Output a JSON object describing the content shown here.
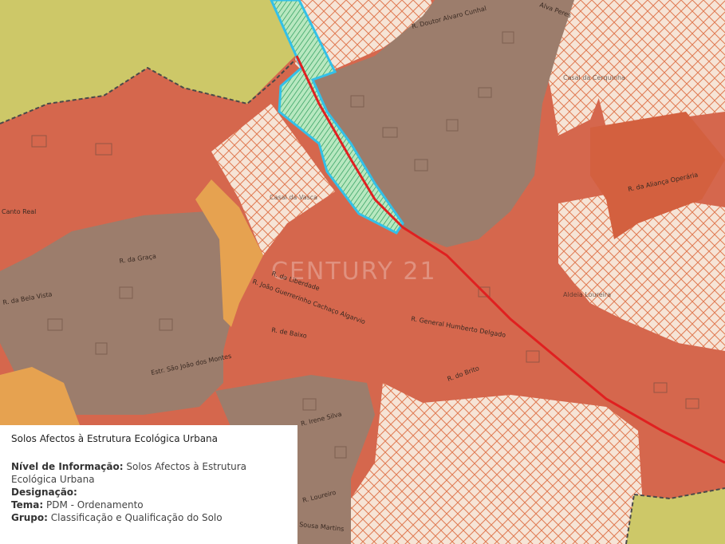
{
  "map": {
    "streets": [
      "R. Doutor Alvaro Cunhal",
      "R. da Graça",
      "R. da Bela Vista",
      "Estr. São João dos Montes",
      "R. General Humberto Delgado",
      "R. do Brito",
      "R. Irene Silva",
      "R. Loureiro",
      "Sousa Martins",
      "R. da Aliança Operária",
      "Canto Real",
      "R. da Liberdade",
      "R. João Guerrerinho Cachaço Algarvio",
      "R. de Baixo",
      "Alva Peres"
    ],
    "places": [
      "Casal da Cerquinha",
      "Casal da Vasca",
      "Aldeia Loureira"
    ],
    "watermark": "CENTURY 21",
    "colors": {
      "urban": "#d4644a",
      "rural_brown": "#9a7a68",
      "green_area": "#c8d070",
      "orange": "#e8a050",
      "eco_structure": "#5ec8a0",
      "border": "#33c0e8",
      "road": "#e02020"
    }
  },
  "info": {
    "title": "Solos Afectos à Estrutura Ecológica Urbana",
    "nivel_label": "Nível de Informação:",
    "nivel_value": "Solos Afectos à Estrutura Ecológica Urbana",
    "designacao_label": "Designação:",
    "tema_label": "Tema:",
    "tema_value": "PDM - Ordenamento",
    "grupo_label": "Grupo:",
    "grupo_value": "Classificação e Qualificação do Solo"
  }
}
